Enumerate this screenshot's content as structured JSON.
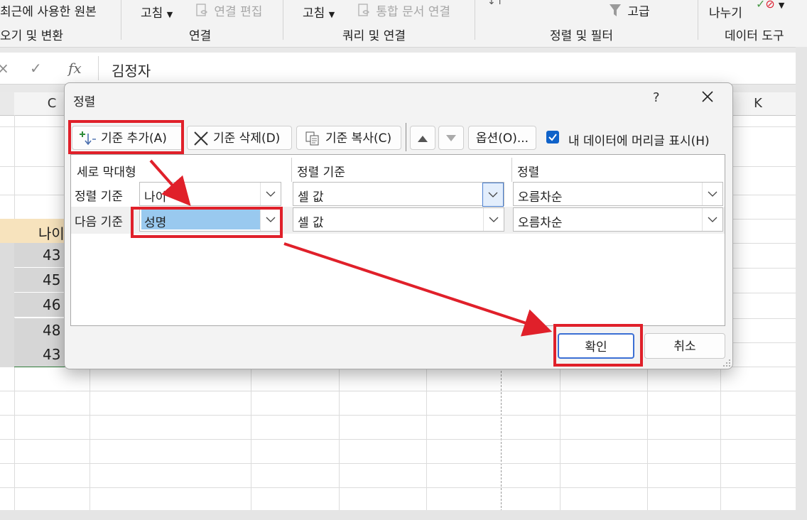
{
  "ribbon": {
    "items": {
      "recent_sources": "최근에 사용한 원본",
      "refresh1": "고침",
      "edit_links": "연결 편집",
      "refresh2": "고침",
      "integrated_doc_link": "통합 문서 연결",
      "advanced": "고급",
      "split": "나누기"
    },
    "groups": {
      "get_transform": "오기 및 변환",
      "connections": "연결",
      "queries": "쿼리 및 연결",
      "sort_filter": "정렬 및 필터",
      "data_tools": "데이터 도구"
    }
  },
  "formula_bar": {
    "fx": "fx",
    "value": "김정자"
  },
  "sheet": {
    "col_headers": [
      "C",
      "K"
    ],
    "header_cell": "나이",
    "ages": [
      "43",
      "45",
      "46",
      "48",
      "43"
    ]
  },
  "dialog": {
    "title": "정렬",
    "help": "?",
    "toolbar": {
      "add_level": "기준 추가(A)",
      "delete_level": "기준 삭제(D)",
      "copy_level": "기준 복사(C)",
      "options": "옵션(O)...",
      "header_checkbox": "내 데이터에 머리글 표시(H)",
      "header_checked": true
    },
    "grid": {
      "headers": [
        "세로 막대형",
        "정렬 기준",
        "정렬"
      ],
      "rows": [
        {
          "label": "정렬 기준",
          "column": "나이",
          "sort_on": "셀 값",
          "order": "오름차순"
        },
        {
          "label": "다음 기준",
          "column": "성명",
          "sort_on": "셀 값",
          "order": "오름차순"
        }
      ]
    },
    "ok": "확인",
    "cancel": "취소"
  },
  "colors": {
    "accent": "#0f62c9",
    "annotation_red": "#e0202a",
    "selection": "#99c9ef"
  }
}
